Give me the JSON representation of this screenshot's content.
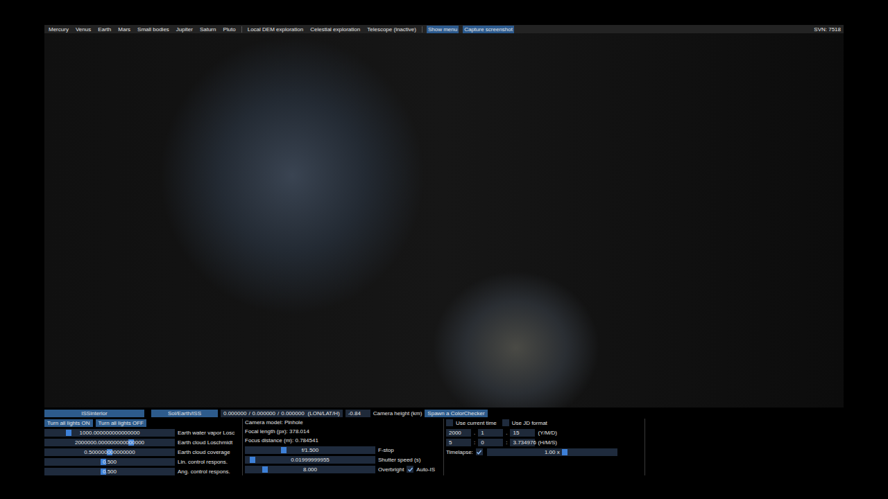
{
  "menu_bar": {
    "groups": [
      [
        {
          "label": "Mercury",
          "highlighted": false
        },
        {
          "label": "Venus",
          "highlighted": false
        },
        {
          "label": "Earth",
          "highlighted": false
        },
        {
          "label": "Mars",
          "highlighted": false
        },
        {
          "label": "Small bodies",
          "highlighted": false
        },
        {
          "label": "Jupiter",
          "highlighted": false
        },
        {
          "label": "Saturn",
          "highlighted": false
        },
        {
          "label": "Pluto",
          "highlighted": false
        }
      ],
      [
        {
          "label": "Local DEM exploration",
          "highlighted": false
        },
        {
          "label": "Celestial exploration",
          "highlighted": false
        },
        {
          "label": "Telescope (inactive)",
          "highlighted": false
        }
      ],
      [
        {
          "label": "Show menu",
          "highlighted": true
        },
        {
          "label": "Capture screenshot",
          "highlighted": true
        }
      ]
    ],
    "status": "SVN: 7518"
  },
  "location_bar": {
    "scene": "ISSinterior",
    "body": "Sol/Earth/ISS",
    "coords": [
      "0.000000",
      "0.000000",
      "0.000000"
    ],
    "coord_separator": "/",
    "coord_unit": "(LON/LAT/H)",
    "height": "-0.84",
    "height_label": "Camera height (km)",
    "spawn_button": "Spawn a ColorChecker"
  },
  "environment_panel": {
    "buttons": [
      "Turn all lights ON",
      "Turn all lights OFF"
    ],
    "sliders": [
      {
        "value": "1000.000000000000000",
        "label": "Earth water vapor Losc",
        "level": 0.17
      },
      {
        "value": "2000000.000000000000000",
        "label": "Earth cloud Loschmidt",
        "level": 0.67
      },
      {
        "value": "0.500000000000000",
        "label": "Earth cloud coverage",
        "level": 0.5
      },
      {
        "value": "0.500",
        "label": "Lin. control respons.",
        "level": 0.45
      },
      {
        "value": "0.500",
        "label": "Ang. control respons.",
        "level": 0.45
      }
    ]
  },
  "camera_panel": {
    "info": [
      "Camera model: Pinhole",
      "Focal length (px): 378.014",
      "Focus distance (m): 0.784541"
    ],
    "sliders": [
      {
        "value": "f/1.500",
        "label": "F-stop",
        "level": 0.29
      },
      {
        "value": "0.01999999955",
        "label": "Shutter speed (s)",
        "level": 0.04
      },
      {
        "value": "8.000",
        "label": "Overbright",
        "level": 0.14
      }
    ],
    "checkbox": {
      "label": "Auto-IS",
      "checked": true
    }
  },
  "time_panel": {
    "checkboxes": [
      {
        "label": "Use current time",
        "checked": false
      },
      {
        "label": "Use JD format",
        "checked": false
      }
    ],
    "date": {
      "fields": [
        "2000",
        "1",
        "15"
      ],
      "separator": ".",
      "unit": "(Y/M/D)"
    },
    "time": {
      "fields": [
        "5",
        "0",
        "3.734976"
      ],
      "separator": ":",
      "unit": "(H/M/S)"
    },
    "timelapse": {
      "label": "Timelapse:",
      "checked": true,
      "value": "1.00 x",
      "level": 0.6
    }
  }
}
